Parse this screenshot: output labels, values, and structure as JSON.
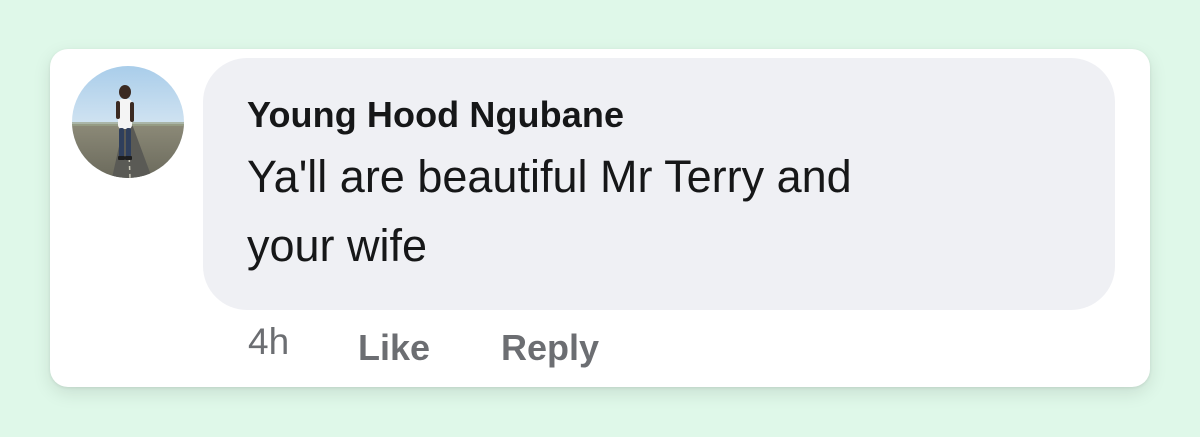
{
  "comment": {
    "avatar_icon": "user-photo-avatar",
    "author": "Young Hood Ngubane",
    "text_lines": [
      "Ya'll are beautiful Mr Terry and",
      "your wife"
    ],
    "timestamp": "4h",
    "like_label": "Like",
    "reply_label": "Reply"
  },
  "colors": {
    "page_background": "#dff8e9",
    "card_background": "#ffffff",
    "bubble_background": "#eff0f4",
    "primary_text": "#161718",
    "secondary_text": "#6c6e72"
  }
}
